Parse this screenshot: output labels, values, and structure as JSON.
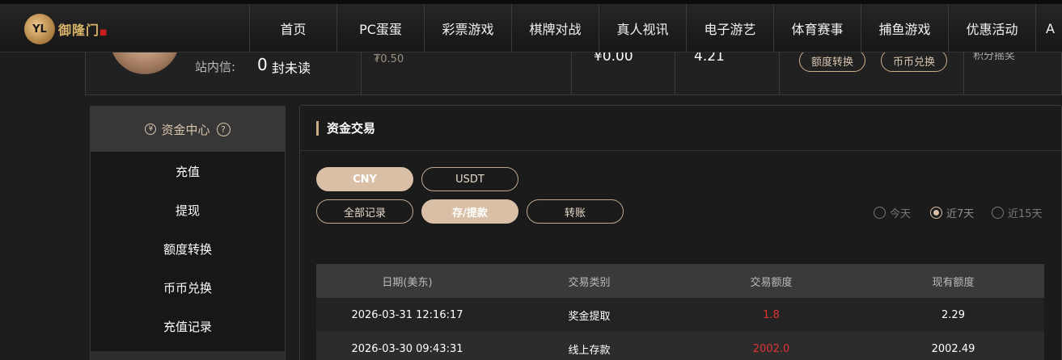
{
  "logo": {
    "mark": "YL",
    "text": "御隆门"
  },
  "nav": [
    "首页",
    "PC蛋蛋",
    "彩票游戏",
    "棋牌对战",
    "真人视讯",
    "电子游艺",
    "体育赛事",
    "捕鱼游戏",
    "优惠活动",
    "A"
  ],
  "user_panel": {
    "inbox_label": "站内信:",
    "inbox_count": "0",
    "inbox_unread": "封未读",
    "balance_small": "₮0.50",
    "balance_cny": "¥0.00",
    "balance_other": "4.21",
    "quota_transfer": "额度转换",
    "coin_exchange": "币币兑换",
    "cut_text": "积分摇奖"
  },
  "sidebar": {
    "title": "资金中心",
    "help": "?",
    "coin_glyph": "¥",
    "items": [
      "充值",
      "提现",
      "额度转换",
      "币币兑换",
      "充值记录"
    ]
  },
  "main": {
    "title": "资金交易",
    "currency_tabs": [
      "CNY",
      "USDT"
    ],
    "record_tabs": [
      "全部记录",
      "存/提款",
      "转账"
    ],
    "ranges": [
      "今天",
      "近7天",
      "近15天"
    ],
    "selected_range": "近7天",
    "table": {
      "headers": [
        "日期(美东)",
        "交易类别",
        "交易额度",
        "现有额度"
      ],
      "rows": [
        [
          "2026-03-31 12:16:17",
          "奖金提取",
          "1.8",
          "2.29"
        ],
        [
          "2026-03-30 09:43:31",
          "线上存款",
          "2002.0",
          "2002.49"
        ]
      ]
    }
  },
  "colors": {
    "accent": "#d8bfa5",
    "amount": "#e03333",
    "background": "#1d1d1d"
  }
}
